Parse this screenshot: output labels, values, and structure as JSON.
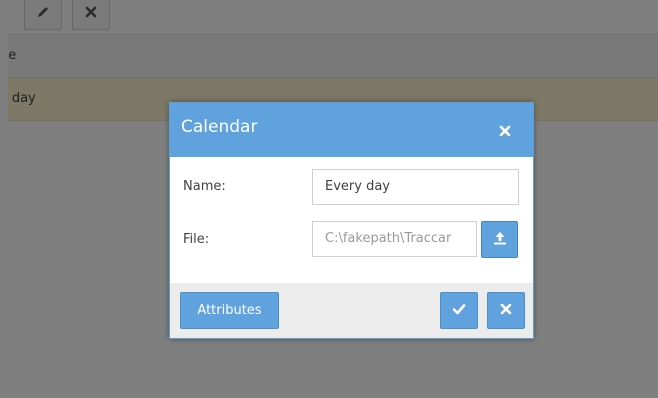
{
  "background": {
    "column_header_fragment": "ne",
    "row_value_fragment": "y day"
  },
  "dialog": {
    "title": "Calendar",
    "name_label": "Name:",
    "name_value": "Every day",
    "file_label": "File:",
    "file_value": "C:\\fakepath\\Traccar",
    "attributes_label": "Attributes"
  },
  "icons": {
    "edit": "pencil-icon",
    "remove": "close-icon",
    "dialog_close": "close-icon",
    "upload": "upload-icon",
    "save": "check-icon",
    "cancel": "close-icon"
  },
  "colors": {
    "accent": "#5fa2dd",
    "selected_row": "#fdf1ce",
    "footer": "#ececec"
  }
}
